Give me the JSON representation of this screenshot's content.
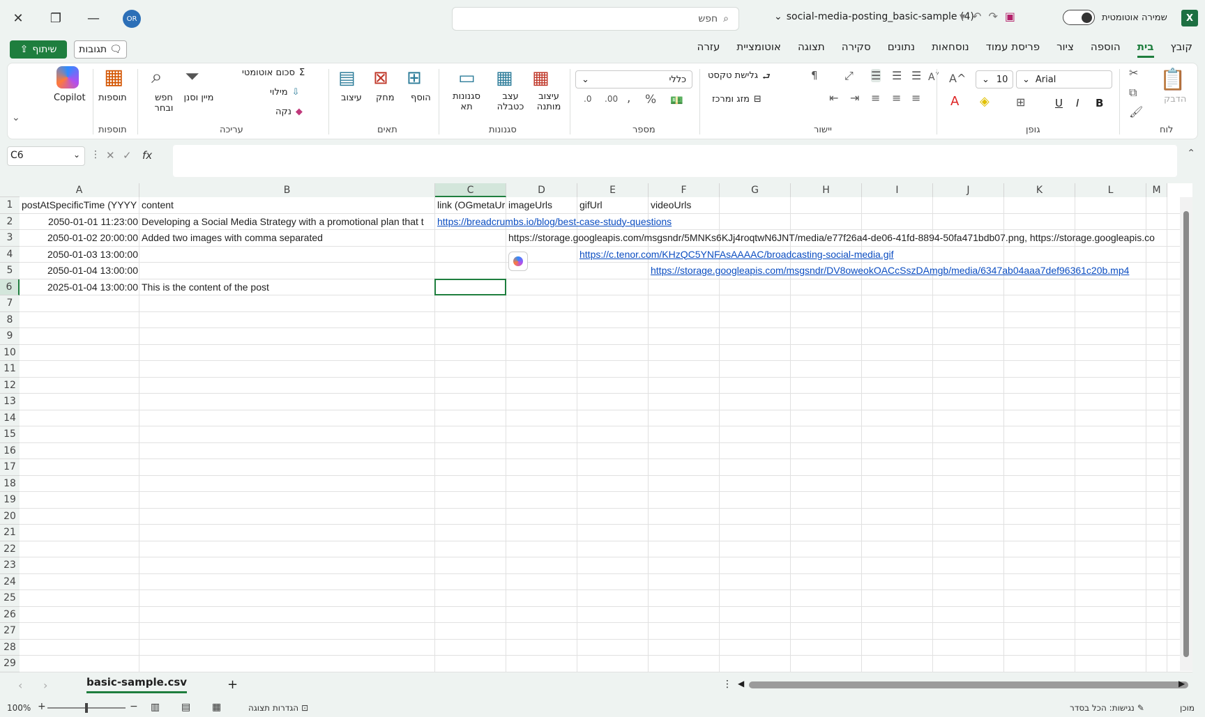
{
  "titlebar": {
    "avatar_initials": "OR",
    "search_placeholder": "חפש",
    "doc_title": "social-media-posting_basic-sample (4)",
    "autosave_label": "שמירה אוטומטית",
    "app_logo": "X"
  },
  "tabs": [
    "קובץ",
    "בית",
    "הוספה",
    "ציור",
    "פריסת עמוד",
    "נוסחאות",
    "נתונים",
    "סקירה",
    "תצוגה",
    "אוטומציית",
    "עזרה"
  ],
  "active_tab": "בית",
  "share_label": "שיתוף",
  "comments_label": "תגובות",
  "ribbon": {
    "paste": "הדבק",
    "clipboard_group": "לוח",
    "font_name": "Arial",
    "font_size": "10",
    "font_group": "גופן",
    "wrap_text": "גלישת טקסט",
    "merge_center": "מזג ומרכז",
    "alignment_group": "יישור",
    "number_format": "כללי",
    "number_group": "מספר",
    "conditional": "עיצוב מותנה",
    "format_table": "עצב כטבלה",
    "cell_styles": "סגנונות תא",
    "styles_group": "סגנונות",
    "insert": "הוסף",
    "delete": "מחק",
    "format": "עיצוב",
    "cells_group": "תאים",
    "autosum": "סכום אוטומטי",
    "fill": "מילוי",
    "clear": "נקה",
    "sort_filter": "מיין וסנן",
    "find_select": "חפש ובחר",
    "editing_group": "עריכה",
    "addins": "תוספות",
    "addins_group": "תוספות",
    "copilot": "Copilot"
  },
  "namebox": "C6",
  "columns": [
    "A",
    "B",
    "C",
    "D",
    "E",
    "F",
    "G",
    "H",
    "I",
    "J",
    "K",
    "L",
    "M"
  ],
  "rows": [
    "1",
    "2",
    "3",
    "4",
    "5",
    "6",
    "7",
    "8",
    "9",
    "10",
    "11",
    "12",
    "13",
    "14",
    "15",
    "16",
    "17",
    "18",
    "19",
    "20",
    "21",
    "22",
    "23",
    "24",
    "25",
    "26",
    "27",
    "28",
    "29"
  ],
  "cells": {
    "A1": "postAtSpecificTime (YYYY",
    "B1": "content",
    "C1": "link (OGmetaUr",
    "D1": "imageUrls",
    "E1": "gifUrl",
    "F1": "videoUrls",
    "A2": "2050-01-01 11:23:00",
    "B2": "Developing a Social Media Strategy with a promotional plan that t",
    "C2": "https://breadcrumbs.io/blog/best-case-study-questions",
    "A3": "2050-01-02 20:00:00",
    "B3": "Added two images with comma separated",
    "D3": "https://storage.googleapis.com/msgsndr/5MNKs6KJj4roqtwN6JNT/media/e77f26a4-de06-41fd-8894-50fa471bdb07.png, https://storage.googleapis.co",
    "A4": "2050-01-03 13:00:00",
    "E4": "https://c.tenor.com/KHzQC5YNFAsAAAAC/broadcasting-social-media.gif",
    "A5": "2050-01-04 13:00:00",
    "F5": "https://storage.googleapis.com/msgsndr/DV8oweokOACcSszDAmgb/media/6347ab04aaa7def96361c20b.mp4",
    "A6": "2025-01-04 13:00:00",
    "B6": "This is the content of the post"
  },
  "sheet_name": "basic-sample.csv",
  "status": {
    "zoom": "100%",
    "ready": "מוכן",
    "accessibility": "נגישות: הכל בסדר",
    "display_settings": "הגדרות תצוגה"
  },
  "colors": {
    "accent": "#1e7e3e",
    "link": "#0b4dc1"
  }
}
